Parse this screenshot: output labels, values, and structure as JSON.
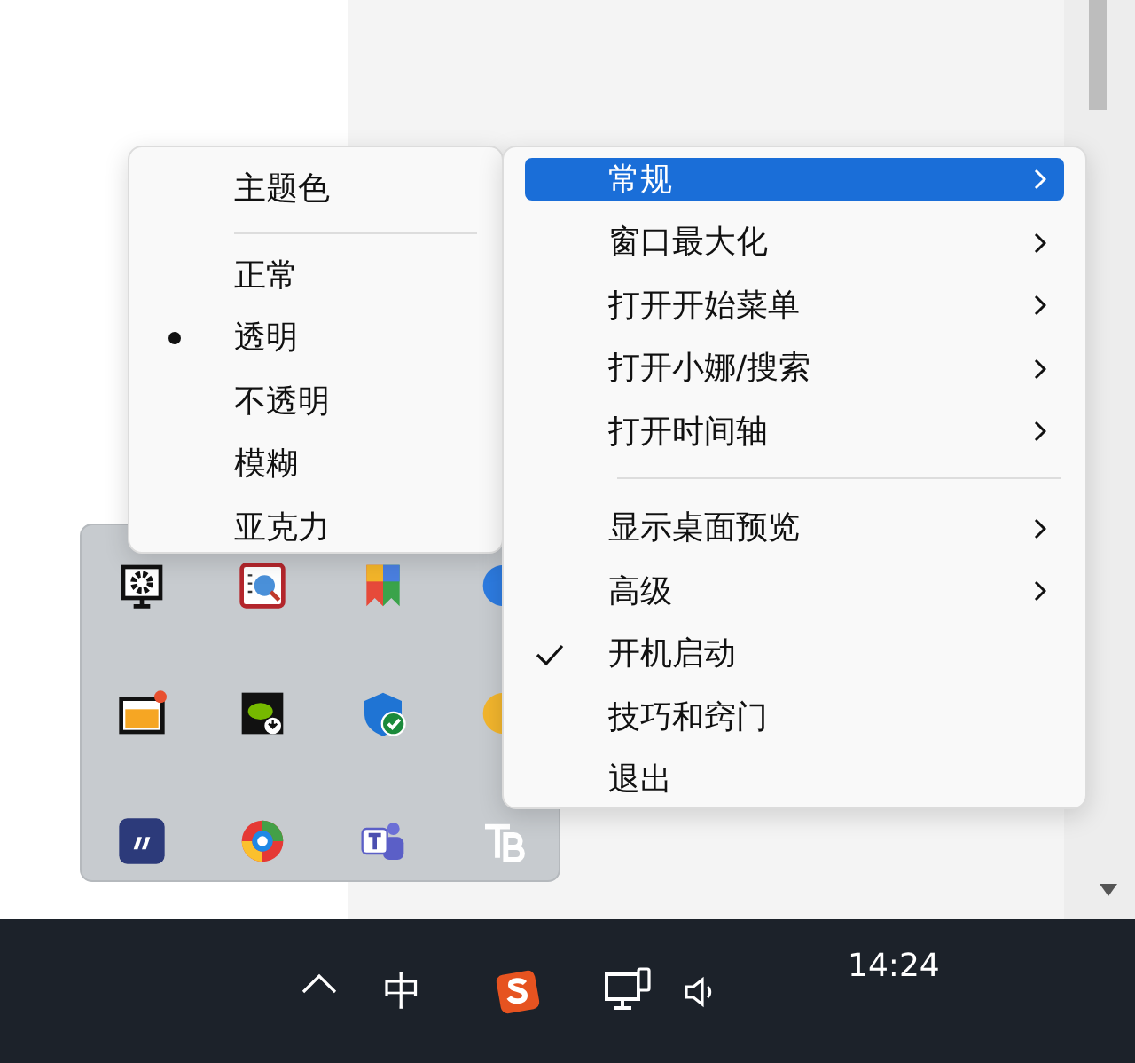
{
  "theme_menu": {
    "items": [
      {
        "kind": "header",
        "label": "主题色"
      },
      {
        "kind": "separator"
      },
      {
        "kind": "option",
        "label": "正常",
        "selected": false
      },
      {
        "kind": "option",
        "label": "透明",
        "selected": true
      },
      {
        "kind": "option",
        "label": "不透明",
        "selected": false
      },
      {
        "kind": "option",
        "label": "模糊",
        "selected": false
      },
      {
        "kind": "option",
        "label": "亚克力",
        "selected": false
      }
    ]
  },
  "context_menu": {
    "items": [
      {
        "kind": "item",
        "label": "常规",
        "selected": true,
        "submenu": true,
        "checked": false
      },
      {
        "kind": "item",
        "label": "窗口最大化",
        "selected": false,
        "submenu": true,
        "checked": false
      },
      {
        "kind": "item",
        "label": "打开开始菜单",
        "selected": false,
        "submenu": true,
        "checked": false
      },
      {
        "kind": "item",
        "label": "打开小娜/搜索",
        "selected": false,
        "submenu": true,
        "checked": false
      },
      {
        "kind": "item",
        "label": "打开时间轴",
        "selected": false,
        "submenu": true,
        "checked": false
      },
      {
        "kind": "separator"
      },
      {
        "kind": "item",
        "label": "显示桌面预览",
        "selected": false,
        "submenu": true,
        "checked": false
      },
      {
        "kind": "item",
        "label": "高级",
        "selected": false,
        "submenu": true,
        "checked": false
      },
      {
        "kind": "item",
        "label": "开机启动",
        "selected": false,
        "submenu": false,
        "checked": true
      },
      {
        "kind": "item",
        "label": "技巧和窍门",
        "selected": false,
        "submenu": false,
        "checked": false
      },
      {
        "kind": "item",
        "label": "退出",
        "selected": false,
        "submenu": false,
        "checked": false
      }
    ]
  },
  "taskbar": {
    "input_method": "中",
    "clock": "14:24"
  }
}
